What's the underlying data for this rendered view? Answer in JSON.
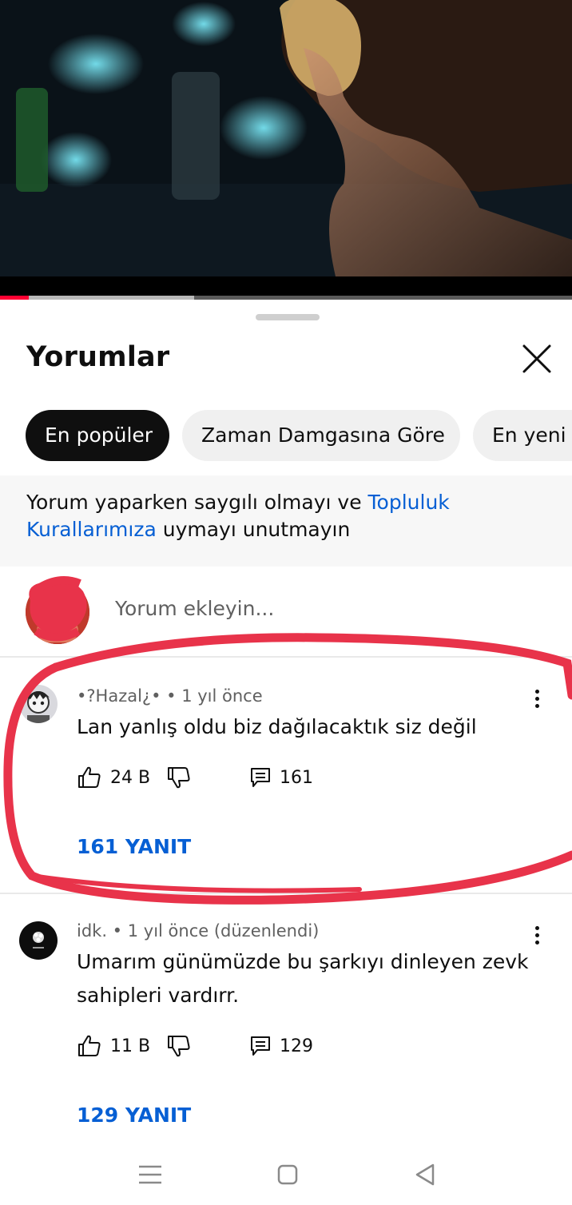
{
  "video": {
    "progress_played": 0.05,
    "progress_buffered": 0.34
  },
  "comments_panel": {
    "title": "Yorumlar",
    "sort_chips": [
      {
        "label": "En popüler",
        "selected": true
      },
      {
        "label": "Zaman Damgasına Göre",
        "selected": false
      },
      {
        "label": "En yeni",
        "selected": false
      }
    ],
    "notice": {
      "before": "Yorum yaparken saygılı olmayı ve ",
      "link": "Topluluk Kurallarımıza",
      "after": " uymayı unutmayın"
    },
    "add_comment_placeholder": "Yorum ekleyin...",
    "comments": [
      {
        "author": "•?Hazal¿•",
        "time": "1 yıl önce",
        "meta": "•?Hazal¿• • 1 yıl önce",
        "text": "Lan yanlış oldu biz dağılacaktık siz değil",
        "likes": "24 B",
        "reply_count": "161",
        "replies_label": "161 YANIT"
      },
      {
        "author": "idk.",
        "time": "1 yıl önce (düzenlendi)",
        "meta": "idk. • 1 yıl önce (düzenlendi)",
        "text": "Umarım günümüzde bu şarkıyı dinleyen zevk sahipleri vardırr.",
        "likes": "11 B",
        "reply_count": "129",
        "replies_label": "129 YANIT"
      }
    ]
  },
  "colors": {
    "accent_link": "#065fd4",
    "progress_red": "#ff0033",
    "annotation_red": "#e8334a",
    "chip_active_bg": "#0f0f0f",
    "chip_bg": "#f0f0f0"
  },
  "icons": [
    "close-icon",
    "like-icon",
    "dislike-icon",
    "reply-icon",
    "more-vert-icon",
    "nav-recents-icon",
    "nav-home-icon",
    "nav-back-icon"
  ]
}
